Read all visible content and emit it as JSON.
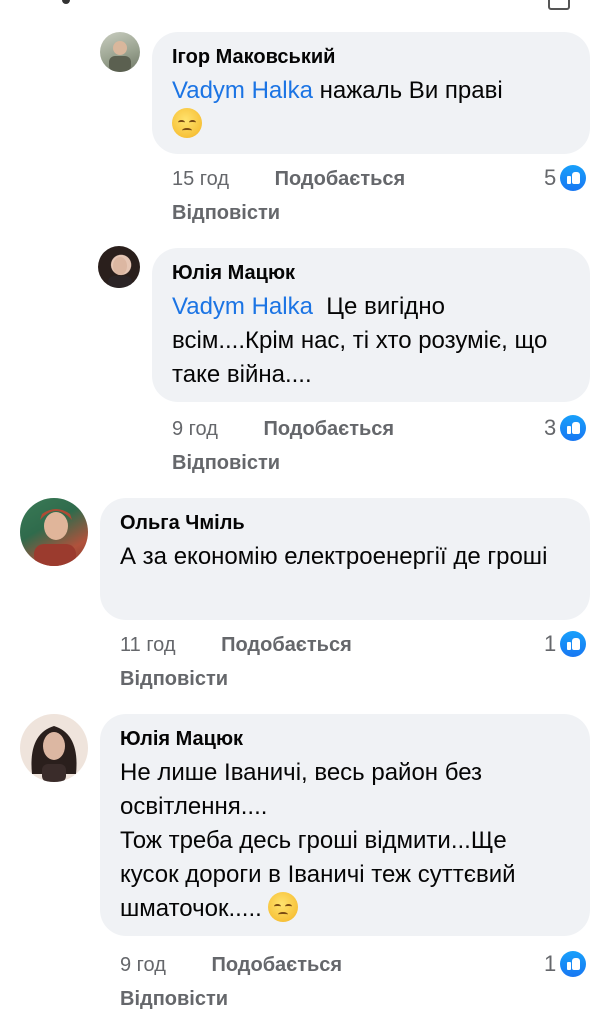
{
  "comments": [
    {
      "author": "Ігор Маковський",
      "mention": "Vadym Halka",
      "text": "нажаль Ви праві",
      "emoji": "pensive-face",
      "time": "15 год",
      "like_label": "Подобається",
      "reply_label": "Відповісти",
      "reactions": "5",
      "avatar_colors": [
        "#9aa390",
        "#c9cdc0"
      ]
    },
    {
      "author": "Юлія Мацюк",
      "mention": "Vadym Halka",
      "text": "Це вигідно всім....Крім нас, ті хто розуміє, що таке війна....",
      "time": "9 год",
      "like_label": "Подобається",
      "reply_label": "Відповісти",
      "reactions": "3",
      "avatar_colors": [
        "#2a1f1c",
        "#d8b8a6"
      ]
    },
    {
      "author": "Ольга Чміль",
      "text": "А за економію електроенергії де гроші",
      "time": "11 год",
      "like_label": "Подобається",
      "reply_label": "Відповісти",
      "reactions": "1",
      "avatar_colors": [
        "#b0523c",
        "#2f6b4c"
      ]
    },
    {
      "author": "Юлія Мацюк",
      "text_lines": [
        "Не лише Іваничі, весь район без освітлення....",
        "Тож треба десь гроші відмити...Ще кусок дороги в Іваничі теж суттєвий шматочок....."
      ],
      "emoji": "pensive-face",
      "time": "9 год",
      "like_label": "Подобається",
      "reply_label": "Відповісти",
      "reactions": "1",
      "avatar_colors": [
        "#2a1f1c",
        "#d8b8a6"
      ]
    }
  ],
  "colors": {
    "bubble": "#f0f2f5",
    "mention": "#1b74e4",
    "meta": "#65676b",
    "like_badge": "#1877f2"
  }
}
